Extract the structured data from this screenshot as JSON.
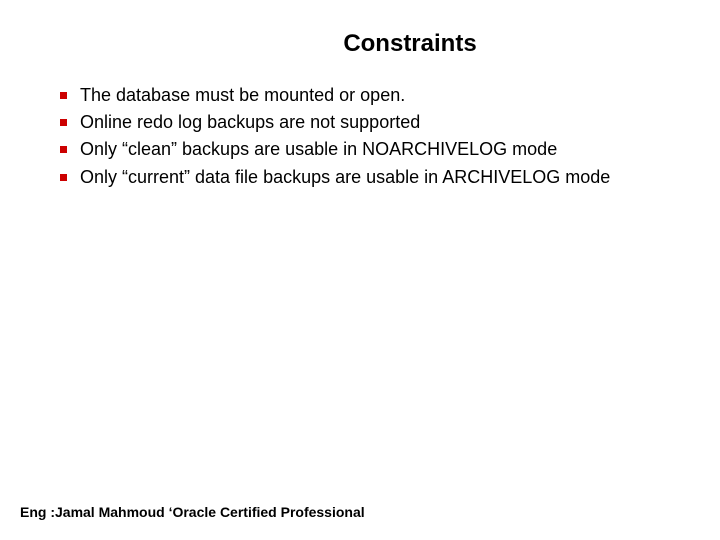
{
  "title": "Constraints",
  "bullets": {
    "item0": "The database must be mounted or open.",
    "item1": "Online redo log backups are not supported",
    "item2": " Only “clean” backups are usable in NOARCHIVELOG mode",
    "item3": " Only “current” data file backups are usable in ARCHIVELOG mode"
  },
  "footer": "Eng :Jamal Mahmoud  ‘Oracle Certified Professional"
}
